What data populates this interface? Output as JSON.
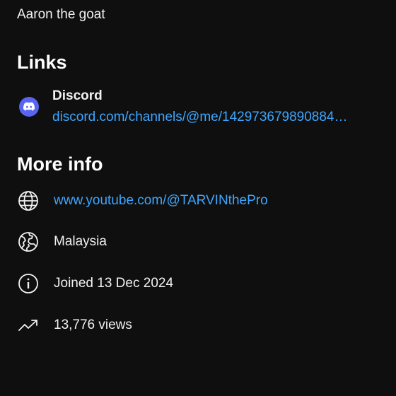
{
  "channel_description": "Aaron the goat",
  "links": {
    "title": "Links",
    "items": [
      {
        "icon": "discord-icon",
        "name": "Discord",
        "url": "discord.com/channels/@me/142973679890884…"
      }
    ]
  },
  "more_info": {
    "title": "More info",
    "website": {
      "icon": "globe-icon",
      "text": "www.youtube.com/@TARVINthePro"
    },
    "country": {
      "icon": "earth-icon",
      "text": "Malaysia"
    },
    "joined": {
      "icon": "info-icon",
      "text": "Joined 13 Dec 2024"
    },
    "views": {
      "icon": "trending-icon",
      "text": "13,776 views"
    }
  },
  "colors": {
    "background": "#0f0f0f",
    "text": "#f1f1f1",
    "link": "#3ea6ff",
    "discord": "#5865f2"
  }
}
